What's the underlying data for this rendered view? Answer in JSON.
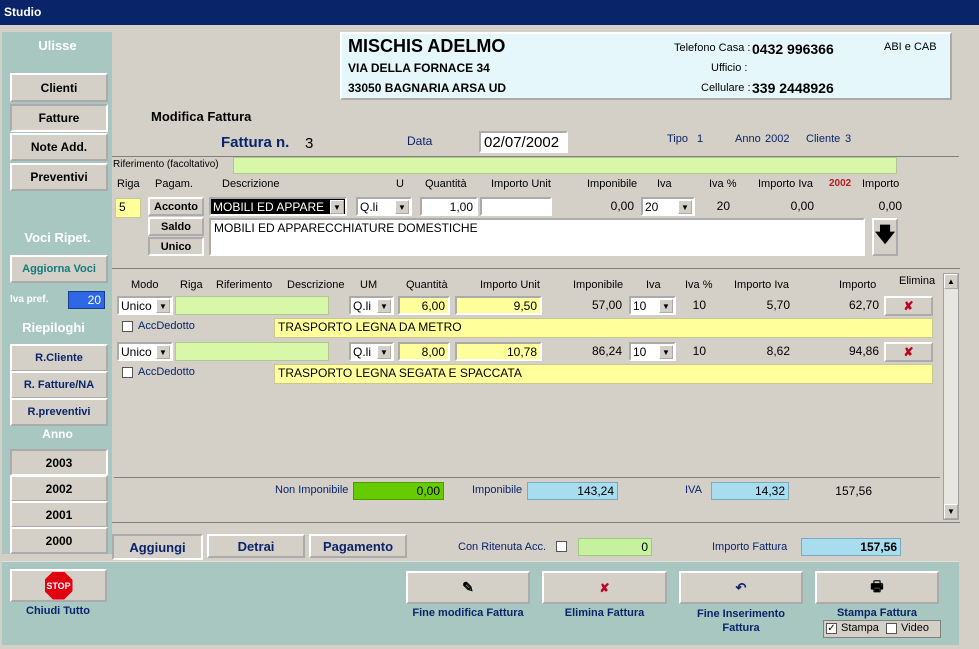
{
  "window": {
    "title": "Studio"
  },
  "sidebar": {
    "app_name": "Ulisse",
    "nav": [
      "Clienti",
      "Fatture",
      "Note Add.",
      "Preventivi"
    ],
    "voci_header": "Voci Ripet.",
    "aggiorna_label": "Aggiorna Voci",
    "iva_pref_label": "Iva pref.",
    "iva_pref_value": "20",
    "riepiloghi_header": "Riepiloghi",
    "riepiloghi": [
      "R.Cliente",
      "R. Fatture/NA",
      "R.preventivi"
    ],
    "anno_header": "Anno",
    "anni": [
      "2003",
      "2002",
      "2001",
      "2000"
    ],
    "chiudi_label": "Chiudi Tutto",
    "stop_text": "STOP"
  },
  "client": {
    "name": "MISCHIS ADELMO",
    "address1": "VIA DELLA FORNACE 34",
    "address2": "33050  BAGNARIA ARSA  UD",
    "tel_label": "Telefono Casa :",
    "tel": "0432 996366",
    "ufficio_label": "Ufficio :",
    "ufficio": "",
    "cell_label": "Cellulare :",
    "cell": "339 2448926",
    "abi_label": "ABI e CAB"
  },
  "invoice": {
    "section_title": "Modifica Fattura",
    "number_label": "Fattura n.",
    "number": "3",
    "data_label": "Data",
    "date": "02/07/2002",
    "tipo_label": "Tipo",
    "tipo": "1",
    "anno_label": "Anno",
    "anno": "2002",
    "cliente_label": "Cliente",
    "cliente": "3",
    "rif_label": "Riferimento (facoltativo)"
  },
  "entry": {
    "headers": [
      "Riga",
      "Pagam.",
      "Descrizione",
      "UM",
      "Quantità",
      "Importo Unit",
      "Imponibile",
      "Iva",
      "Iva %",
      "Importo Iva",
      "2002",
      "Importo"
    ],
    "riga": "5",
    "pag_buttons": [
      "Acconto",
      "Saldo",
      "Unico"
    ],
    "descrizione": "MOBILI ED APPARE",
    "um": "Q.li",
    "quantita": "1,00",
    "importo_unit": "",
    "imponibile": "0,00",
    "iva": "20",
    "iva_pct": "20",
    "importo_iva": "0,00",
    "importo": "0,00",
    "descrizione_long": "MOBILI ED APPARECCHIATURE DOMESTICHE"
  },
  "lines": {
    "headers": [
      "Modo",
      "Riga",
      "Riferimento",
      "Descrizione",
      "UM",
      "Quantità",
      "Importo Unit",
      "Imponibile",
      "Iva",
      "Iva %",
      "Importo Iva",
      "Importo",
      "Elimina"
    ],
    "acc_label": "AccDedotto",
    "rows": [
      {
        "modo": "Unico",
        "um": "Q.li",
        "quantita": "6,00",
        "importo_unit": "9,50",
        "imponibile": "57,00",
        "iva": "10",
        "iva_pct": "10",
        "importo_iva": "5,70",
        "importo": "62,70",
        "descrizione": "TRASPORTO LEGNA DA METRO"
      },
      {
        "modo": "Unico",
        "um": "Q.li",
        "quantita": "8,00",
        "importo_unit": "10,78",
        "imponibile": "86,24",
        "iva": "10",
        "iva_pct": "10",
        "importo_iva": "8,62",
        "importo": "94,86",
        "descrizione": "TRASPORTO LEGNA SEGATA E SPACCATA"
      }
    ]
  },
  "totals": {
    "non_imponibile_label": "Non Imponibile",
    "non_imponibile": "0,00",
    "imponibile_label": "Imponibile",
    "imponibile": "143,24",
    "iva_label": "IVA",
    "iva": "14,32",
    "totale": "157,56"
  },
  "tabs": [
    "Aggiungi",
    "Detrai",
    "Pagamento"
  ],
  "ritenuta": {
    "label": "Con Ritenuta Acc.",
    "value": "0"
  },
  "importo_fattura": {
    "label": "Importo Fattura",
    "value": "157,56"
  },
  "actions": [
    {
      "label": "Fine modifica Fattura"
    },
    {
      "label": "Elimina Fattura"
    },
    {
      "label": "Fine Inserimento Fattura"
    },
    {
      "label": "Stampa Fattura"
    }
  ],
  "print": {
    "stampa": "Stampa",
    "video": "Video"
  }
}
